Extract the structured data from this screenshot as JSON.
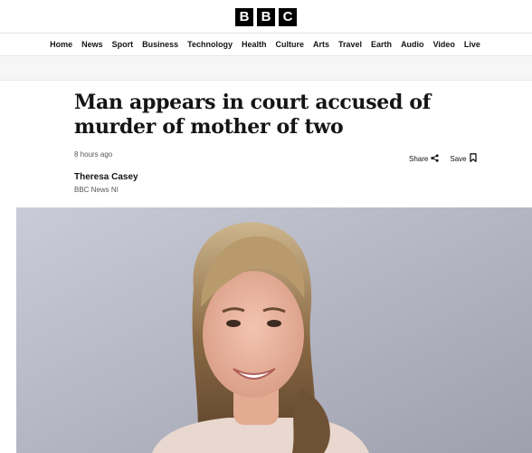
{
  "masthead": {
    "logo_letters": [
      "B",
      "B",
      "C"
    ]
  },
  "nav": {
    "items": [
      "Home",
      "News",
      "Sport",
      "Business",
      "Technology",
      "Health",
      "Culture",
      "Arts",
      "Travel",
      "Earth",
      "Audio",
      "Video",
      "Live"
    ]
  },
  "article": {
    "headline": "Man appears in court accused of murder of mother of two",
    "timestamp": "8 hours ago",
    "author": "Theresa Casey",
    "organization": "BBC News NI",
    "share_label": "Share",
    "save_label": "Save"
  },
  "icons": {
    "share": "share-icon",
    "save": "bookmark-icon"
  },
  "colors": {
    "logo_bg": "#000000",
    "text": "#141414",
    "muted": "#545658",
    "grey_band": "#f6f6f6"
  }
}
